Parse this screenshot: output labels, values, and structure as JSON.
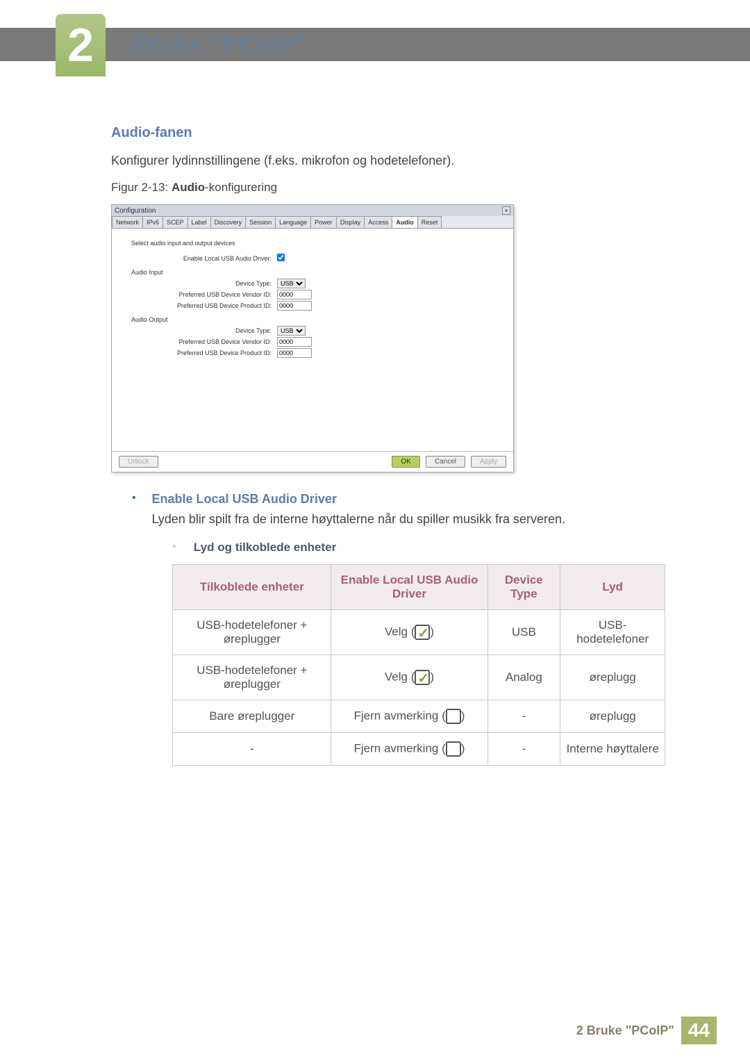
{
  "chapter": {
    "number": "2",
    "title": "Bruke \"PCoIP\""
  },
  "section": {
    "heading": "Audio-fanen",
    "intro": "Konfigurer lydinnstillingene (f.eks. mikrofon og hodetelefoner).",
    "figure_prefix": "Figur 2-13: ",
    "figure_bold": "Audio",
    "figure_suffix": "-konfigurering"
  },
  "window": {
    "title": "Configuration",
    "close": "×",
    "tabs": [
      "Network",
      "IPv6",
      "SCEP",
      "Label",
      "Discovery",
      "Session",
      "Language",
      "Power",
      "Display",
      "Access",
      "Audio",
      "Reset"
    ],
    "active_tab": "Audio",
    "help": "Select audio input and output devices",
    "row_enable": "Enable Local USB Audio Driver:",
    "group_input": "Audio Input",
    "group_output": "Audio Output",
    "row_device": "Device Type:",
    "row_vendor": "Preferred USB Device Vendor ID:",
    "row_product": "Preferred USB Device Product ID:",
    "device_value": "USB",
    "id_value": "0000",
    "buttons": {
      "unlock": "Unlock",
      "ok": "OK",
      "cancel": "Cancel",
      "apply": "Apply"
    }
  },
  "bullet": {
    "heading": "Enable Local USB Audio Driver",
    "body": "Lyden blir spilt fra de interne høyttalerne når du spiller musikk fra serveren."
  },
  "subbullet": {
    "heading": "Lyd og tilkoblede enheter"
  },
  "table": {
    "headers": [
      "Tilkoblede enheter",
      "Enable Local USB Audio Driver",
      "Device Type",
      "Lyd"
    ],
    "rows": [
      {
        "c0": "USB-hodetelefoner + øreplugger",
        "c1a": "Velg (",
        "c1b": ")",
        "checked": true,
        "c2": "USB",
        "c3": "USB-hodetelefoner"
      },
      {
        "c0": "USB-hodetelefoner + øreplugger",
        "c1a": "Velg (",
        "c1b": ")",
        "checked": true,
        "c2": "Analog",
        "c3": "øreplugg"
      },
      {
        "c0": "Bare øreplugger",
        "c1a": "Fjern avmerking (",
        "c1b": ")",
        "checked": false,
        "c2": "-",
        "c3": "øreplugg"
      },
      {
        "c0": "-",
        "c1a": "Fjern avmerking (",
        "c1b": ")",
        "checked": false,
        "c2": "-",
        "c3": "Interne høyttalere"
      }
    ]
  },
  "footer": {
    "text": "2 Bruke \"PCoIP\"",
    "page": "44"
  }
}
